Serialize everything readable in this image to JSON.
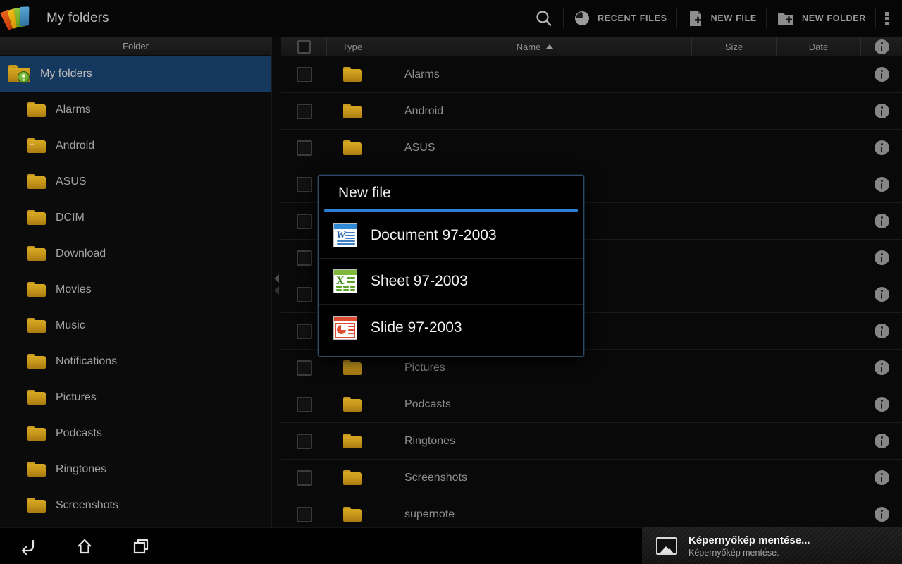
{
  "app": {
    "title": "My folders",
    "logo_icon": "colored-folders-logo"
  },
  "actionbar": {
    "search_icon": "search-icon",
    "recent": {
      "label": "RECENT FILES",
      "icon": "clock-icon"
    },
    "new_file": {
      "label": "NEW FILE",
      "icon": "new-file-icon"
    },
    "new_folder": {
      "label": "NEW FOLDER",
      "icon": "new-folder-icon"
    },
    "overflow_icon": "overflow-menu-icon"
  },
  "sidebar": {
    "header": "Folder",
    "items": [
      {
        "label": "My folders",
        "selected": true,
        "icon": "folder-user-icon"
      },
      {
        "label": "Alarms",
        "selected": false,
        "icon": "folder-icon"
      },
      {
        "label": "Android",
        "selected": false,
        "icon": "folder-plus-icon"
      },
      {
        "label": "ASUS",
        "selected": false,
        "icon": "folder-plus-icon"
      },
      {
        "label": "DCIM",
        "selected": false,
        "icon": "folder-plus-icon"
      },
      {
        "label": "Download",
        "selected": false,
        "icon": "folder-plus-icon"
      },
      {
        "label": "Movies",
        "selected": false,
        "icon": "folder-icon"
      },
      {
        "label": "Music",
        "selected": false,
        "icon": "folder-icon"
      },
      {
        "label": "Notifications",
        "selected": false,
        "icon": "folder-icon"
      },
      {
        "label": "Pictures",
        "selected": false,
        "icon": "folder-icon"
      },
      {
        "label": "Podcasts",
        "selected": false,
        "icon": "folder-icon"
      },
      {
        "label": "Ringtones",
        "selected": false,
        "icon": "folder-icon"
      },
      {
        "label": "Screenshots",
        "selected": false,
        "icon": "folder-icon"
      }
    ],
    "handle_icon": "collapse-handle-icon"
  },
  "filelist": {
    "columns": {
      "check": "",
      "type": "Type",
      "name": "Name",
      "size": "Size",
      "date": "Date",
      "info": "info-icon"
    },
    "sort_column": "Name",
    "sort_direction": "ascending",
    "rows": [
      {
        "name": "Alarms",
        "type": "folder",
        "size": "",
        "date": ""
      },
      {
        "name": "Android",
        "type": "folder",
        "size": "",
        "date": ""
      },
      {
        "name": "ASUS",
        "type": "folder",
        "size": "",
        "date": ""
      },
      {
        "name": "",
        "type": "folder",
        "size": "",
        "date": ""
      },
      {
        "name": "",
        "type": "folder",
        "size": "",
        "date": ""
      },
      {
        "name": "",
        "type": "folder",
        "size": "",
        "date": ""
      },
      {
        "name": "",
        "type": "folder",
        "size": "",
        "date": ""
      },
      {
        "name": "",
        "type": "folder",
        "size": "",
        "date": ""
      },
      {
        "name": "Pictures",
        "type": "folder",
        "size": "",
        "date": ""
      },
      {
        "name": "Podcasts",
        "type": "folder",
        "size": "",
        "date": ""
      },
      {
        "name": "Ringtones",
        "type": "folder",
        "size": "",
        "date": ""
      },
      {
        "name": "Screenshots",
        "type": "folder",
        "size": "",
        "date": ""
      },
      {
        "name": "supernote",
        "type": "folder",
        "size": "",
        "date": ""
      }
    ]
  },
  "dialog": {
    "title": "New file",
    "accent_color": "#2c7fd4",
    "options": [
      {
        "label": "Document 97-2003",
        "icon": "word-document-icon"
      },
      {
        "label": "Sheet 97-2003",
        "icon": "excel-sheet-icon"
      },
      {
        "label": "Slide 97-2003",
        "icon": "powerpoint-slide-icon"
      }
    ]
  },
  "systembar": {
    "back_icon": "back-icon",
    "home_icon": "home-icon",
    "recents_icon": "recent-apps-icon",
    "notification": {
      "icon": "image-icon",
      "title": "Képernyőkép mentése...",
      "subtitle": "Képernyőkép mentése."
    }
  }
}
